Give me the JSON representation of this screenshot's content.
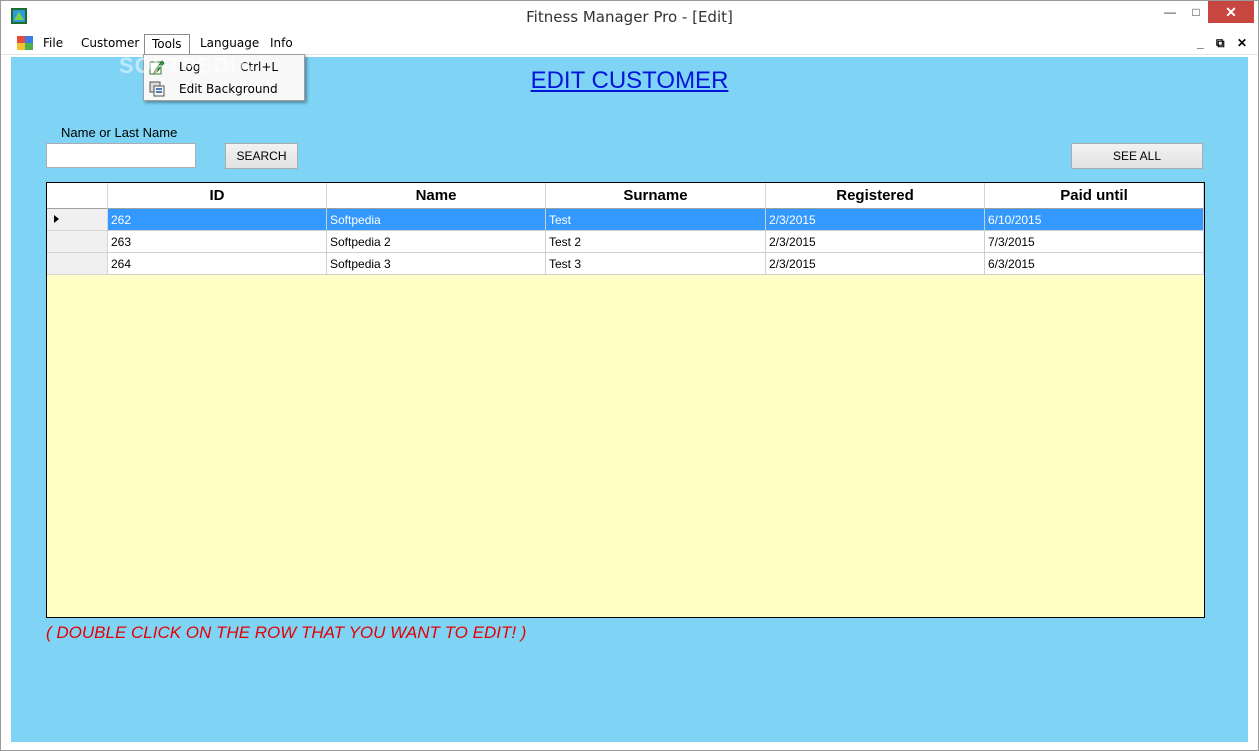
{
  "window": {
    "title": "Fitness Manager Pro - [Edit]",
    "controls": {
      "minimize": "—",
      "maximize": "□",
      "close": "✕"
    }
  },
  "menubar": {
    "items": [
      "File",
      "Customer",
      "Tools",
      "Language",
      "Info"
    ],
    "active": "Tools",
    "mdi_controls": {
      "minimize": "_",
      "restore": "⧉",
      "close": "✕"
    }
  },
  "tools_menu": {
    "items": [
      {
        "label": "Log",
        "shortcut": "Ctrl+L",
        "icon": "pencil-edit-icon"
      },
      {
        "label": "Edit Background",
        "shortcut": "",
        "icon": "background-icon"
      }
    ]
  },
  "watermark": "SOFTPEDIA",
  "page": {
    "heading": "EDIT CUSTOMER",
    "search_label": "Name or Last Name",
    "search_value": "",
    "search_button": "SEARCH",
    "see_all_button": "SEE ALL",
    "hint": "( DOUBLE CLICK ON THE ROW THAT YOU WANT TO EDIT! )"
  },
  "table": {
    "columns": [
      "ID",
      "Name",
      "Surname",
      "Registered",
      "Paid until"
    ],
    "rows": [
      [
        "262",
        "Softpedia",
        "Test",
        "2/3/2015",
        "6/10/2015"
      ],
      [
        "263",
        "Softpedia 2",
        "Test 2",
        "2/3/2015",
        "7/3/2015"
      ],
      [
        "264",
        "Softpedia 3",
        "Test 3",
        "2/3/2015",
        "6/3/2015"
      ]
    ],
    "selected_row": 0
  },
  "colors": {
    "background": "#7fd4f6",
    "grid_empty": "#ffffc6",
    "heading": "#0015d8",
    "hint": "#e40000",
    "selection": "#3399ff",
    "close_button": "#c7463f"
  }
}
